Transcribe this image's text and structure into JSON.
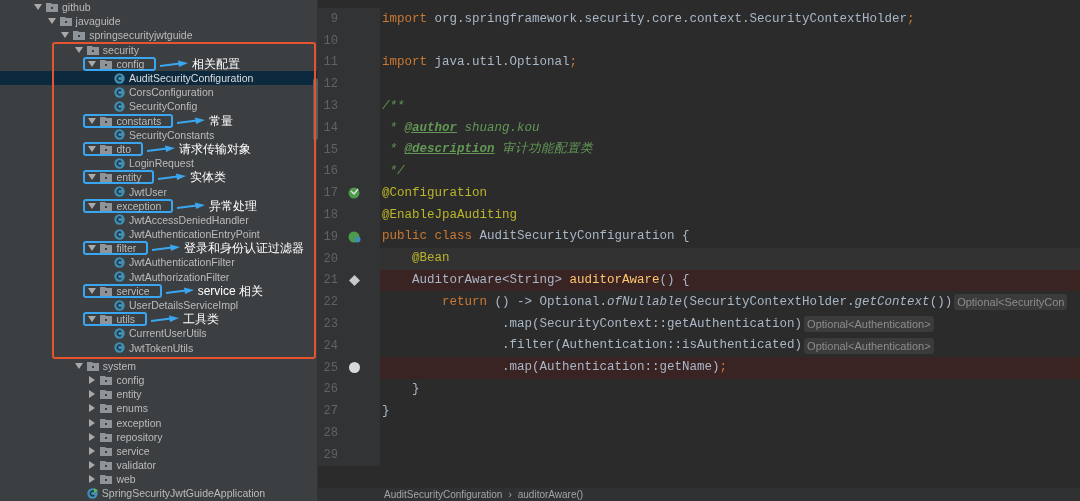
{
  "project_tree": [
    {
      "name": "github",
      "kind": "folder",
      "expanded": true,
      "selected": false,
      "children": [
        {
          "name": "javaguide",
          "kind": "folder",
          "expanded": true,
          "selected": false,
          "children": [
            {
              "name": "springsecurityjwtguide",
              "kind": "folder",
              "expanded": true,
              "selected": false,
              "children": [
                {
                  "name": "security",
                  "kind": "folder",
                  "expanded": true,
                  "selected": false,
                  "framed": true,
                  "children": [
                    {
                      "name": "config",
                      "kind": "folder",
                      "expanded": true,
                      "selected": false,
                      "callout": "相关配置",
                      "children": [
                        {
                          "name": "AuditSecurityConfiguration",
                          "kind": "class",
                          "selected": true
                        },
                        {
                          "name": "CorsConfiguration",
                          "kind": "class",
                          "selected": false
                        },
                        {
                          "name": "SecurityConfig",
                          "kind": "class",
                          "selected": false
                        }
                      ]
                    },
                    {
                      "name": "constants",
                      "kind": "folder",
                      "expanded": true,
                      "selected": false,
                      "callout": "常量",
                      "children": [
                        {
                          "name": "SecurityConstants",
                          "kind": "class",
                          "selected": false
                        }
                      ]
                    },
                    {
                      "name": "dto",
                      "kind": "folder",
                      "expanded": true,
                      "selected": false,
                      "callout": "请求传输对象",
                      "children": [
                        {
                          "name": "LoginRequest",
                          "kind": "class",
                          "selected": false
                        }
                      ]
                    },
                    {
                      "name": "entity",
                      "kind": "folder",
                      "expanded": true,
                      "selected": false,
                      "callout": "实体类",
                      "children": [
                        {
                          "name": "JwtUser",
                          "kind": "class",
                          "selected": false
                        }
                      ]
                    },
                    {
                      "name": "exception",
                      "kind": "folder",
                      "expanded": true,
                      "selected": false,
                      "callout": "异常处理",
                      "children": [
                        {
                          "name": "JwtAccessDeniedHandler",
                          "kind": "class",
                          "selected": false
                        },
                        {
                          "name": "JwtAuthenticationEntryPoint",
                          "kind": "class",
                          "selected": false
                        }
                      ]
                    },
                    {
                      "name": "filter",
                      "kind": "folder",
                      "expanded": true,
                      "selected": false,
                      "callout": "登录和身份认证过滤器",
                      "children": [
                        {
                          "name": "JwtAuthenticationFilter",
                          "kind": "class",
                          "selected": false
                        },
                        {
                          "name": "JwtAuthorizationFilter",
                          "kind": "class",
                          "selected": false
                        }
                      ]
                    },
                    {
                      "name": "service",
                      "kind": "folder",
                      "expanded": true,
                      "selected": false,
                      "callout": "service 相关",
                      "children": [
                        {
                          "name": "UserDetailsServiceImpl",
                          "kind": "class",
                          "selected": false
                        }
                      ]
                    },
                    {
                      "name": "utils",
                      "kind": "folder",
                      "expanded": true,
                      "selected": false,
                      "callout": "工具类",
                      "children": [
                        {
                          "name": "CurrentUserUtils",
                          "kind": "class",
                          "selected": false
                        },
                        {
                          "name": "JwtTokenUtils",
                          "kind": "class",
                          "selected": false
                        }
                      ]
                    }
                  ]
                },
                {
                  "name": "system",
                  "kind": "folder",
                  "expanded": true,
                  "selected": false,
                  "children": [
                    {
                      "name": "config",
                      "kind": "folder",
                      "expanded": false,
                      "selected": false
                    },
                    {
                      "name": "entity",
                      "kind": "folder",
                      "expanded": false,
                      "selected": false
                    },
                    {
                      "name": "enums",
                      "kind": "folder",
                      "expanded": false,
                      "selected": false
                    },
                    {
                      "name": "exception",
                      "kind": "folder",
                      "expanded": false,
                      "selected": false
                    },
                    {
                      "name": "repository",
                      "kind": "folder",
                      "expanded": false,
                      "selected": false
                    },
                    {
                      "name": "service",
                      "kind": "folder",
                      "expanded": false,
                      "selected": false
                    },
                    {
                      "name": "validator",
                      "kind": "folder",
                      "expanded": false,
                      "selected": false
                    },
                    {
                      "name": "web",
                      "kind": "folder",
                      "expanded": false,
                      "selected": false
                    }
                  ]
                },
                {
                  "name": "SpringSecurityJwtGuideApplication",
                  "kind": "app",
                  "selected": false
                }
              ]
            }
          ]
        }
      ]
    }
  ],
  "editor": {
    "lines": [
      {
        "number": "9",
        "current": false,
        "breakpoint": false,
        "tokens": [
          {
            "text": "import ",
            "kind": "keyword"
          },
          {
            "text": "org.springframework.security.core.context.SecurityContextHolder",
            "kind": "plain"
          },
          {
            "text": ";",
            "kind": "keyword"
          }
        ]
      },
      {
        "number": "10",
        "current": false,
        "breakpoint": false
      },
      {
        "number": "11",
        "current": false,
        "breakpoint": false,
        "tokens": [
          {
            "text": "import ",
            "kind": "keyword"
          },
          {
            "text": "java.util.Optional",
            "kind": "plain"
          },
          {
            "text": ";",
            "kind": "keyword"
          }
        ]
      },
      {
        "number": "12",
        "current": false,
        "breakpoint": false
      },
      {
        "number": "13",
        "current": false,
        "breakpoint": false,
        "tokens": [
          {
            "text": "/**",
            "kind": "comment"
          }
        ]
      },
      {
        "number": "14",
        "current": false,
        "breakpoint": false,
        "tokens": [
          {
            "text": " * ",
            "kind": "comment"
          },
          {
            "text": "@author",
            "kind": "doctag"
          },
          {
            "text": " shuang.kou",
            "kind": "comment"
          }
        ]
      },
      {
        "number": "15",
        "current": false,
        "breakpoint": false,
        "tokens": [
          {
            "text": " * ",
            "kind": "comment"
          },
          {
            "text": "@description",
            "kind": "doctag"
          },
          {
            "text": " 审计功能配置类",
            "kind": "comment"
          }
        ]
      },
      {
        "number": "16",
        "current": false,
        "breakpoint": false,
        "tokens": [
          {
            "text": " */",
            "kind": "comment"
          }
        ]
      },
      {
        "number": "17",
        "current": false,
        "breakpoint": false,
        "gutter_icon": {
          "kind": "bean"
        },
        "tokens": [
          {
            "text": "@Configuration",
            "kind": "annotation"
          }
        ]
      },
      {
        "number": "18",
        "current": false,
        "breakpoint": false,
        "tokens": [
          {
            "text": "@EnableJpaAuditing",
            "kind": "annotation"
          }
        ]
      },
      {
        "number": "19",
        "current": false,
        "breakpoint": false,
        "gutter_icon": {
          "kind": "bean-link"
        },
        "tokens": [
          {
            "text": "public class ",
            "kind": "keyword"
          },
          {
            "text": "AuditSecurityConfiguration {",
            "kind": "plain"
          }
        ]
      },
      {
        "number": "20",
        "current": true,
        "breakpoint": false,
        "tokens": [
          {
            "text": "    @Bean",
            "kind": "annotation"
          }
        ]
      },
      {
        "number": "21",
        "current": false,
        "breakpoint": true,
        "gutter_icon": {
          "kind": "diamond"
        },
        "tokens": [
          {
            "text": "    AuditorAware<String> ",
            "kind": "plain"
          },
          {
            "text": "auditorAware",
            "kind": "method"
          },
          {
            "text": "() {",
            "kind": "plain"
          }
        ]
      },
      {
        "number": "22",
        "current": false,
        "breakpoint": false,
        "tokens": [
          {
            "text": "        return ",
            "kind": "keyword"
          },
          {
            "text": "() -> Optional.",
            "kind": "plain"
          },
          {
            "text": "ofNullable",
            "kind": "italic"
          },
          {
            "text": "(SecurityContextHolder.",
            "kind": "plain"
          },
          {
            "text": "getContext",
            "kind": "italic"
          },
          {
            "text": "())",
            "kind": "plain"
          },
          {
            "text": "Optional<SecurityCon",
            "kind": "hint"
          }
        ]
      },
      {
        "number": "23",
        "current": false,
        "breakpoint": false,
        "tokens": [
          {
            "text": "                .map(SecurityContext::getAuthentication)",
            "kind": "plain"
          },
          {
            "text": "Optional<Authentication>",
            "kind": "hint"
          }
        ]
      },
      {
        "number": "24",
        "current": false,
        "breakpoint": false,
        "tokens": [
          {
            "text": "                .filter(Authentication::isAuthenticated)",
            "kind": "plain"
          },
          {
            "text": "Optional<Authentication>",
            "kind": "hint"
          }
        ]
      },
      {
        "number": "25",
        "current": false,
        "breakpoint": true,
        "gutter_icon": {
          "kind": "circle"
        },
        "tokens": [
          {
            "text": "                .map(Authentication::getName)",
            "kind": "plain"
          },
          {
            "text": ";",
            "kind": "keyword"
          }
        ]
      },
      {
        "number": "26",
        "current": false,
        "breakpoint": false,
        "tokens": [
          {
            "text": "    }",
            "kind": "plain"
          }
        ]
      },
      {
        "number": "27",
        "current": false,
        "breakpoint": false,
        "tokens": [
          {
            "text": "}",
            "kind": "plain"
          }
        ]
      },
      {
        "number": "28",
        "current": false,
        "breakpoint": false
      },
      {
        "number": "29",
        "current": false,
        "breakpoint": false
      }
    ]
  },
  "breadcrumbs": {
    "separator": "›",
    "items": [
      "AuditSecurityConfiguration",
      "auditorAware()"
    ]
  }
}
